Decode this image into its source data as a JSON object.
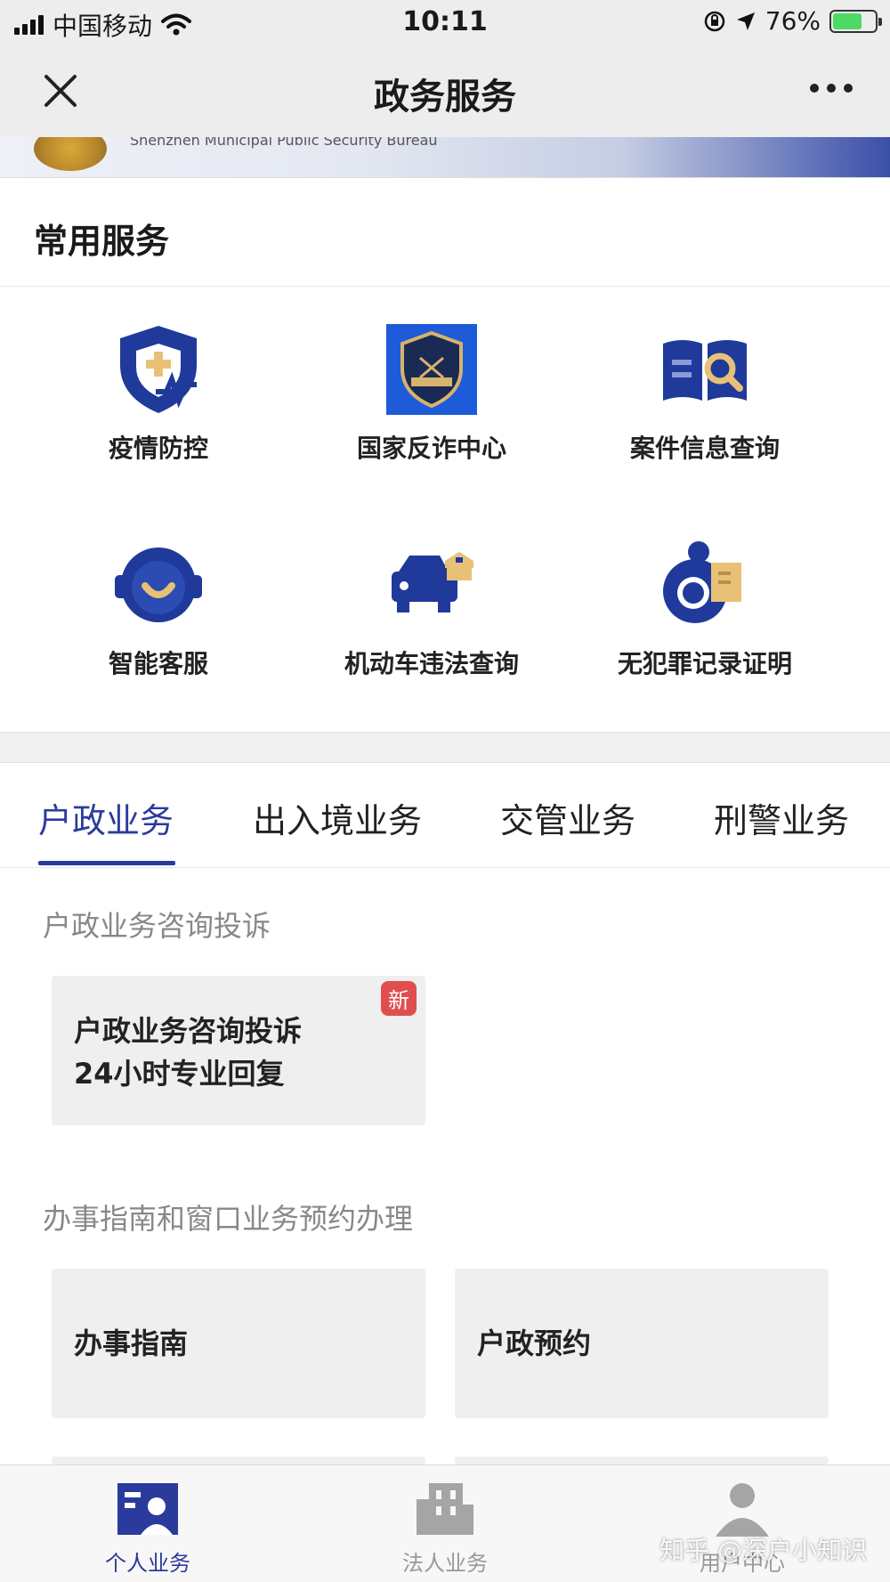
{
  "status_bar": {
    "carrier": "中国移动",
    "time": "10:11",
    "battery": "76%"
  },
  "nav": {
    "title": "政务服务"
  },
  "banner": {
    "text": "Shenzhen Municipal Public Security Bureau"
  },
  "common_services": {
    "title": "常用服务",
    "items": [
      {
        "label": "疫情防控",
        "icon": "shield-health-icon"
      },
      {
        "label": "国家反诈中心",
        "icon": "anti-fraud-badge-icon"
      },
      {
        "label": "案件信息查询",
        "icon": "book-search-icon"
      },
      {
        "label": "智能客服",
        "icon": "customer-service-icon"
      },
      {
        "label": "机动车违法查询",
        "icon": "police-car-icon"
      },
      {
        "label": "无犯罪记录证明",
        "icon": "certificate-icon"
      }
    ]
  },
  "tabs": [
    "户政业务",
    "出入境业务",
    "交管业务",
    "刑警业务"
  ],
  "sections": [
    {
      "title": "户政业务咨询投诉",
      "cards": [
        {
          "line1": "户政业务咨询投诉",
          "line2": "24小时专业回复",
          "badge": "新"
        }
      ]
    },
    {
      "title": "办事指南和窗口业务预约办理",
      "cards": [
        {
          "label": "办事指南"
        },
        {
          "label": "户政预约"
        }
      ]
    }
  ],
  "bottom_tabs": [
    "个人业务",
    "法人业务",
    "用户中心"
  ],
  "watermark": "知乎 @深户小知识",
  "colors": {
    "accent": "#2b3b9b",
    "icon_blue": "#1f3a9a",
    "icon_gold": "#e8c177",
    "badge_red": "#e04f4f"
  }
}
